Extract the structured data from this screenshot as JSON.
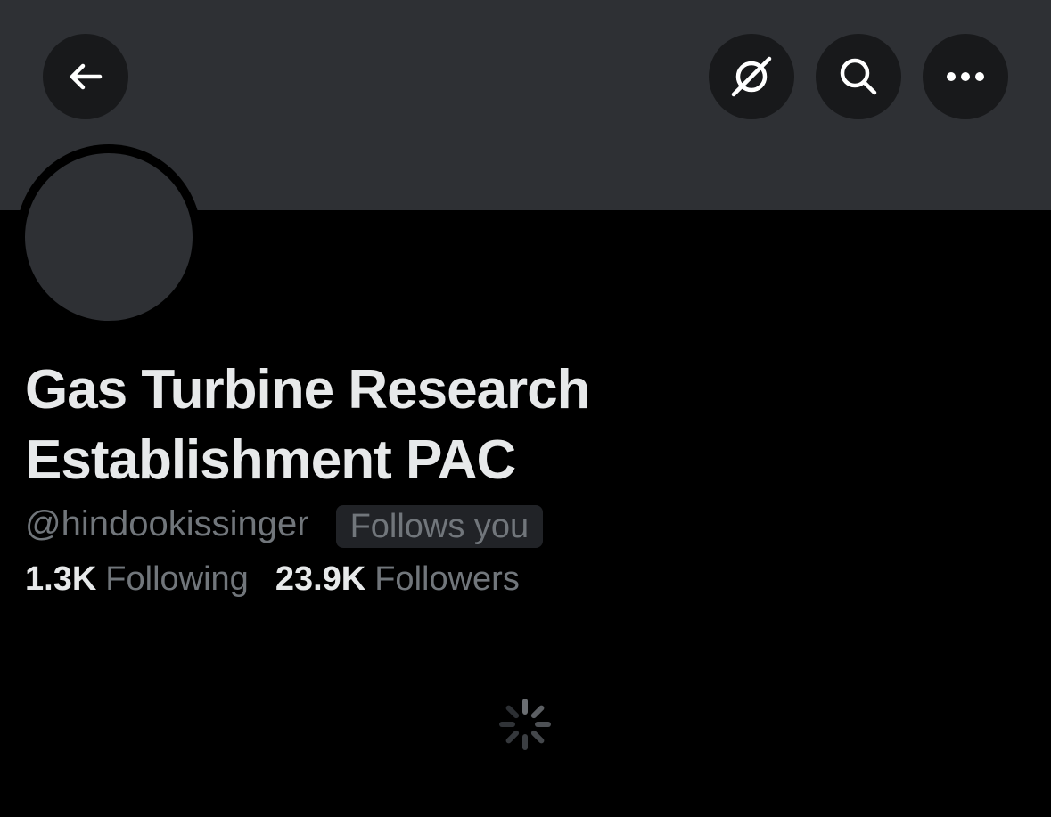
{
  "header": {
    "back_icon": "arrow-left-icon",
    "hide_icon": "eye-slash-icon",
    "search_icon": "search-icon",
    "more_icon": "more-horizontal-icon",
    "banner_color": "#2e3034",
    "button_color": "#18191b"
  },
  "profile": {
    "display_name_line1": "Gas Turbine Research",
    "display_name_line2": "Establishment PAC",
    "handle": "@hindookissinger",
    "follows_you_badge": "Follows you",
    "avatar_color": "#2e3034"
  },
  "stats": {
    "following_count": "1.3K",
    "following_label": "Following",
    "followers_count": "23.9K",
    "followers_label": "Followers"
  },
  "content": {
    "loading_icon": "loading-spinner-icon"
  },
  "colors": {
    "background": "#000000",
    "primary_text": "#e7e9ea",
    "secondary_text": "#71767b",
    "badge_background": "#212327"
  }
}
